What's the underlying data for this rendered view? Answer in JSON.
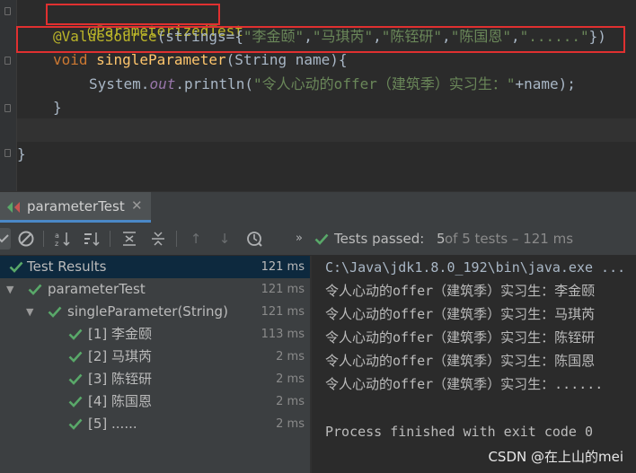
{
  "editor": {
    "line1": {
      "annotation": "@ParameterizedTest"
    },
    "line2": {
      "annotation": "@ValueSource",
      "open": "(strings={",
      "str1": "\"李金颐\"",
      "str2": "\"马琪芮\"",
      "str3": "\"陈铚研\"",
      "str4": "\"陈国恩\"",
      "str5": "\"......\"",
      "comma": ",",
      "close": "})"
    },
    "line3": {
      "keyword": "void",
      "method": "singleParameter",
      "params": "(String name){"
    },
    "line4": {
      "prefix": "System.",
      "field": "out",
      "call": ".println(",
      "literal": "\"令人心动的offer（建筑季）实习生：\"",
      "suffix": "+name);"
    },
    "line5": {
      "text": "}"
    },
    "line6": {
      "text": "}"
    }
  },
  "run_window": {
    "tab_label": "parameterTest",
    "status": {
      "passed_prefix": "Tests passed: ",
      "passed_count": "5",
      "of_text": " of 5 tests – 121 ms"
    },
    "tree": [
      {
        "label": "Test Results",
        "time": "121 ms",
        "selected": true
      },
      {
        "label": "parameterTest",
        "time": "121 ms"
      },
      {
        "label": "singleParameter(String)",
        "time": "121 ms"
      },
      {
        "label": "[1] 李金颐",
        "time": "113 ms"
      },
      {
        "label": "[2] 马琪芮",
        "time": "2 ms"
      },
      {
        "label": "[3] 陈铚研",
        "time": "2 ms"
      },
      {
        "label": "[4] 陈国恩",
        "time": "2 ms"
      },
      {
        "label": "[5] ......",
        "time": "2 ms"
      }
    ],
    "console": [
      "C:\\Java\\jdk1.8.0_192\\bin\\java.exe ...",
      "令人心动的offer（建筑季）实习生：李金颐",
      "令人心动的offer（建筑季）实习生：马琪芮",
      "令人心动的offer（建筑季）实习生：陈铚研",
      "令人心动的offer（建筑季）实习生：陈国恩",
      "令人心动的offer（建筑季）实习生：......",
      "",
      "Process finished with exit code 0"
    ],
    "watermark": "CSDN @在上山的mei"
  },
  "colors": {
    "check_green": "#59a869",
    "highlight_red": "#e03030",
    "selected_row": "#0d293e",
    "annotation": "#bbb529",
    "string": "#6a8759",
    "keyword": "#cc7832"
  },
  "icons": [
    "run-config-icon",
    "close-icon",
    "rerun-icon",
    "stop-icon",
    "sort-alpha-icon",
    "sort-duration-icon",
    "expand-all-icon",
    "collapse-all-icon",
    "previous-icon",
    "next-icon",
    "history-icon",
    "more-icon",
    "check-icon",
    "chevron-down-icon"
  ]
}
